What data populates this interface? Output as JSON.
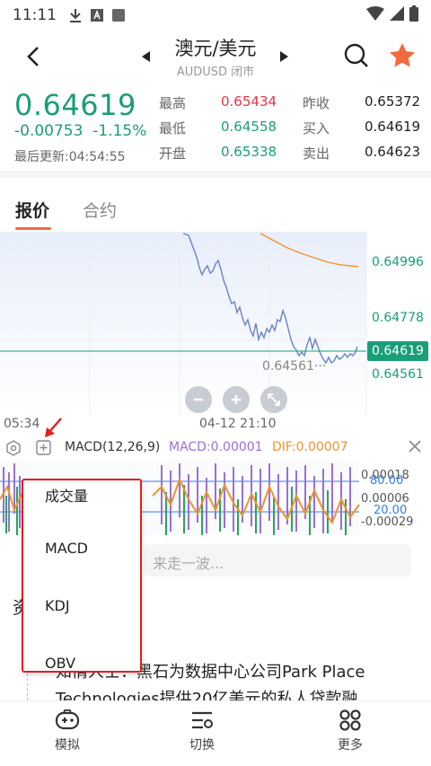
{
  "status_bar": {
    "time": "11:11"
  },
  "header": {
    "title": "澳元/美元",
    "subtitle": "AUDUSD 闭市"
  },
  "quote": {
    "price": "0.64619",
    "change": "-0.00753",
    "change_pct": "-1.15%",
    "updated": "最后更新:04:54:55",
    "stats": [
      {
        "label": "最高",
        "value": "0.65434"
      },
      {
        "label": "最低",
        "value": "0.64558"
      },
      {
        "label": "开盘",
        "value": "0.65338"
      },
      {
        "label": "昨收",
        "value": "0.65372"
      },
      {
        "label": "买入",
        "value": "0.64619"
      },
      {
        "label": "卖出",
        "value": "0.64623"
      }
    ]
  },
  "tabs": [
    "报价",
    "合约"
  ],
  "chart": {
    "price_labels": [
      "0.64996",
      "0.64778",
      "0.64619",
      "0.64561"
    ],
    "min_note": "0.64561",
    "x_labels": [
      "05:34",
      "04-12 21:10"
    ]
  },
  "indicator": {
    "name": "MACD(12,26,9)",
    "macd": "MACD:0.00001",
    "dif": "DIF:0.00007",
    "axis_labels": [
      "0.00018",
      "80.00",
      "0.00006",
      "20.00",
      "-0.00029"
    ]
  },
  "dropdown": {
    "items": [
      "成交量",
      "MACD",
      "KDJ",
      "OBV"
    ]
  },
  "news": {
    "search_placeholder": "来走一波...",
    "section_title": "资",
    "text_line1": "知情人士：黑石为数据中心公司Park Place",
    "text_line2": "Technologies提供20亿美元的私人贷款融"
  },
  "bottom_nav": [
    "模拟",
    "切换",
    "更多"
  ],
  "colors": {
    "up_green": "#1a9e79",
    "down_red": "#e53545",
    "accent": "#f26a3d"
  }
}
